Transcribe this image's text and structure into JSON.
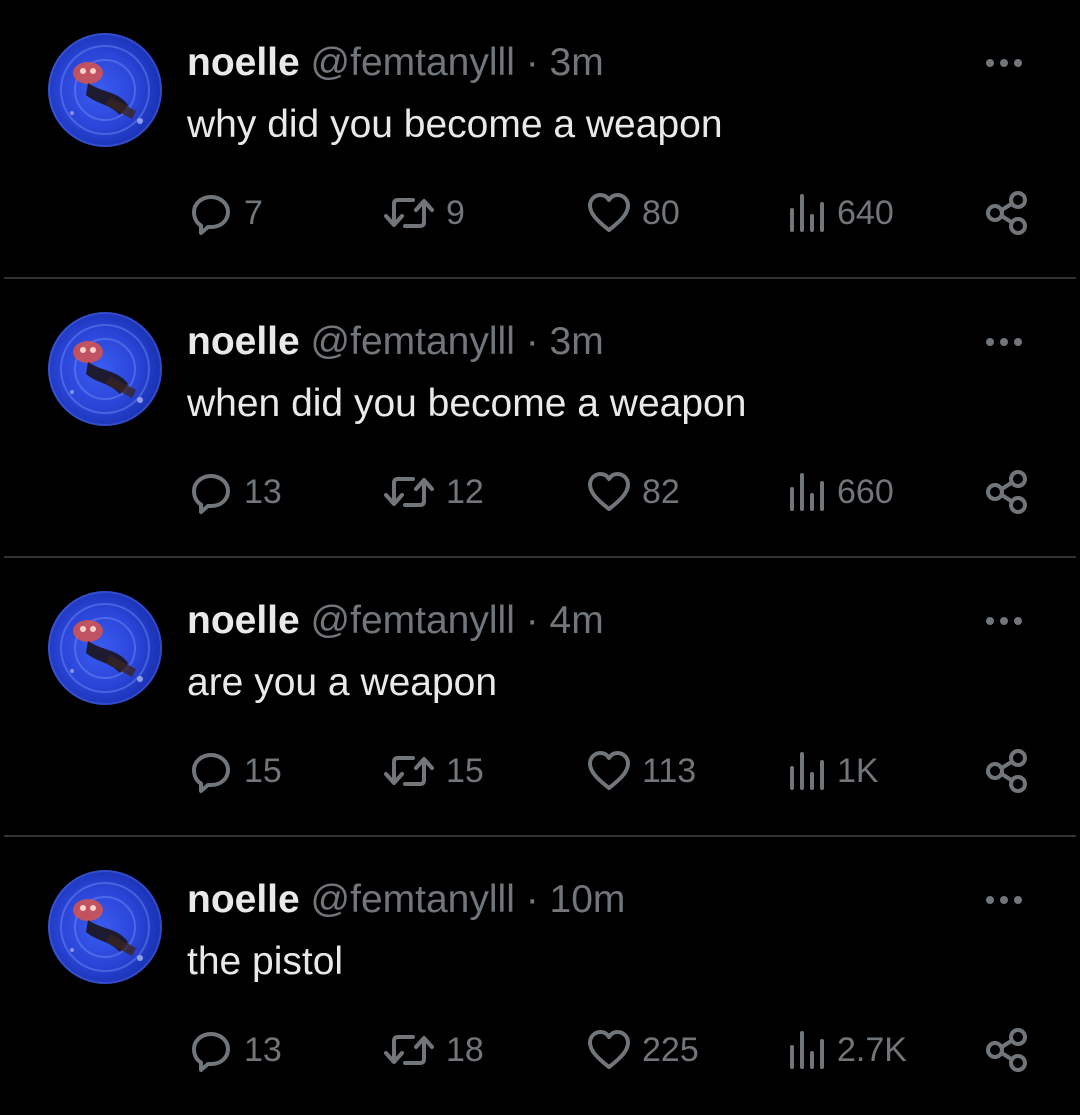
{
  "tweets": [
    {
      "display_name": "noelle",
      "handle": "@femtanylll",
      "separator": "·",
      "time": "3m",
      "text": "why did you become a weapon",
      "replies": "7",
      "retweets": "9",
      "likes": "80",
      "views": "640"
    },
    {
      "display_name": "noelle",
      "handle": "@femtanylll",
      "separator": "·",
      "time": "3m",
      "text": "when did you become a weapon",
      "replies": "13",
      "retweets": "12",
      "likes": "82",
      "views": "660"
    },
    {
      "display_name": "noelle",
      "handle": "@femtanylll",
      "separator": "·",
      "time": "4m",
      "text": "are you a weapon",
      "replies": "15",
      "retweets": "15",
      "likes": "113",
      "views": "1K"
    },
    {
      "display_name": "noelle",
      "handle": "@femtanylll",
      "separator": "·",
      "time": "10m",
      "text": "the pistol",
      "replies": "13",
      "retweets": "18",
      "likes": "225",
      "views": "2.7K"
    }
  ],
  "icons": {
    "more": "more-options-icon",
    "reply": "reply-icon",
    "retweet": "retweet-icon",
    "like": "heart-icon",
    "views": "views-chart-icon",
    "share": "share-icon"
  },
  "colors": {
    "background": "#000000",
    "primary_text": "#e7e9ea",
    "secondary_text": "#71767b",
    "divider": "#2f3336",
    "avatar_blue": "#2a45d8"
  }
}
